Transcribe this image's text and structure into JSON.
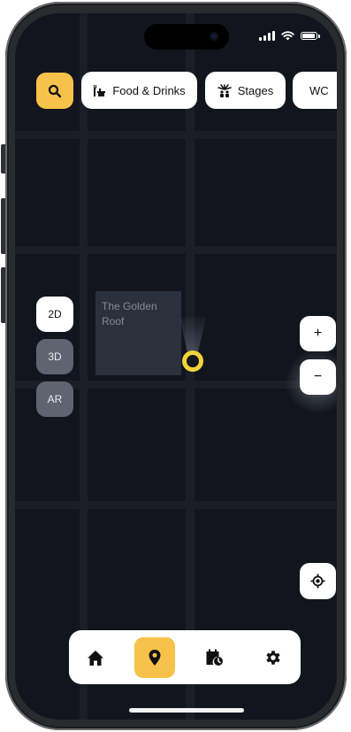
{
  "colors": {
    "accent": "#f7c24a",
    "map_background": "#12151d",
    "road": "#1b1e27",
    "building": "#2b313c",
    "user_location": "#f2d43a"
  },
  "search": {
    "icon": "search-icon"
  },
  "filters": [
    {
      "label": "Food & Drinks",
      "icon": "food-drinks-icon"
    },
    {
      "label": "Stages",
      "icon": "stages-icon"
    },
    {
      "label": "WC",
      "icon": ""
    }
  ],
  "map": {
    "building_label": "The Golden Roof"
  },
  "view_modes": [
    {
      "label": "2D",
      "selected": true
    },
    {
      "label": "3D",
      "selected": false
    },
    {
      "label": "AR",
      "selected": false
    }
  ],
  "zoom": {
    "in_label": "+",
    "out_label": "−"
  },
  "locate": {
    "icon": "locate-icon"
  },
  "tabbar": {
    "tabs": [
      {
        "name": "home",
        "icon": "home-icon",
        "active": false
      },
      {
        "name": "map",
        "icon": "map-pin-icon",
        "active": true
      },
      {
        "name": "schedule",
        "icon": "schedule-icon",
        "active": false
      },
      {
        "name": "settings",
        "icon": "gear-icon",
        "active": false
      }
    ]
  }
}
